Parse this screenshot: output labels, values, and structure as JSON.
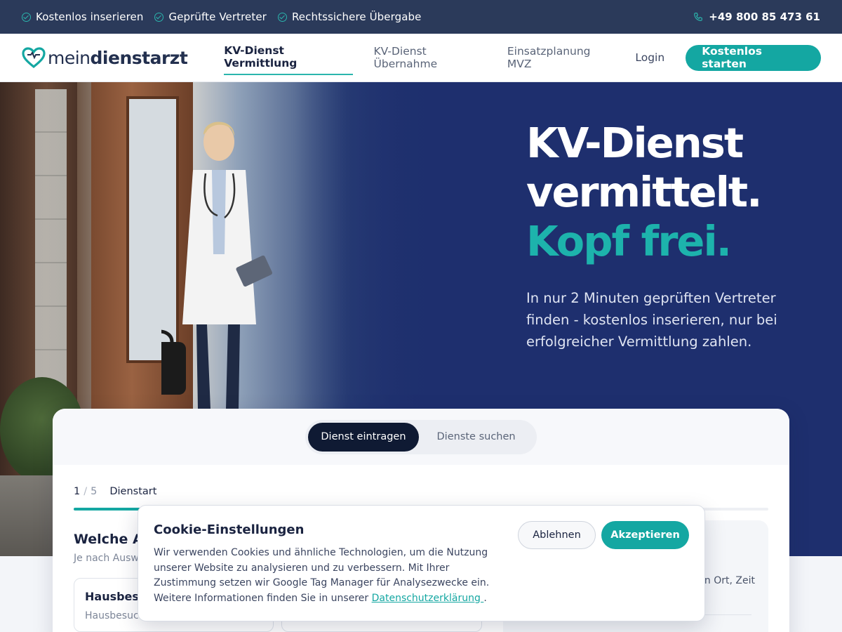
{
  "topbar": {
    "usps": [
      "Kostenlos inserieren",
      "Geprüfte Vertreter",
      "Rechtssichere Übergabe"
    ],
    "phone": "+49 800 85 473 61"
  },
  "nav": {
    "logo_mein": "mein",
    "logo_rest": "dienstarzt",
    "items": [
      "KV-Dienst Vermittlung",
      "KV-Dienst Übernahme",
      "Einsatzplanung MVZ"
    ],
    "login": "Login",
    "cta": "Kostenlos starten"
  },
  "hero": {
    "line1": "KV-Dienst",
    "line2": "vermittelt.",
    "accent": "Kopf frei.",
    "subtitle": "In nur 2 Minuten geprüften Vertreter finden - kostenlos inserieren, nur bei erfolgreicher Vermittlung zahlen."
  },
  "form": {
    "toggle_on": "Dienst eintragen",
    "toggle_off": "Dienste suchen",
    "step_current": "1",
    "step_sep": "/",
    "step_total": "5",
    "step_label": "Dienstart",
    "progress": 0.2,
    "question": "Welche Ar",
    "question_sub": "Je nach Ausw",
    "option1_title": "Hausbesu",
    "option1_desc": "Hausbesuch",
    "aside_snippet": "in Ort, Zeit"
  },
  "cookie": {
    "title": "Cookie-Einstellungen",
    "text": "Wir verwenden Cookies und ähnliche Technologien, um die Nutzung unserer Website zu analysieren und zu verbessern. Mit Ihrer Zustimmung setzen wir Google Tag Manager für Analysezwecke ein. Weitere Informationen finden Sie in unserer ",
    "link": "Datenschutzerklärung ",
    "text_end": ".",
    "decline": "Ablehnen",
    "accept": "Akzeptieren"
  },
  "colors": {
    "accent": "#14a7a2",
    "navy": "#1e2f6e",
    "topbar": "#2b3a5a"
  }
}
